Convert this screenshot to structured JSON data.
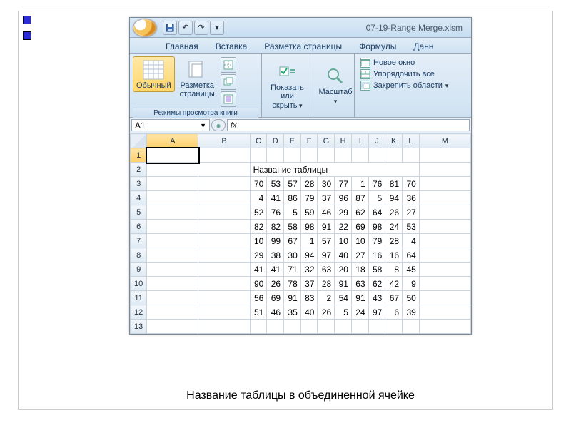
{
  "titlebar": {
    "filename": "07-19-Range Merge.xlsm"
  },
  "tabs": {
    "home": "Главная",
    "insert": "Вставка",
    "layout": "Разметка страницы",
    "formulas": "Формулы",
    "data": "Данн"
  },
  "ribbon": {
    "views_group_label": "Режимы просмотра книги",
    "normal": "Обычный",
    "pagelayout_l1": "Разметка",
    "pagelayout_l2": "страницы",
    "showhide_l1": "Показать",
    "showhide_l2": "или скрыть",
    "zoom": "Масштаб",
    "newwin": "Новое окно",
    "arrange": "Упорядочить все",
    "freeze": "Закрепить области"
  },
  "namebox": {
    "value": "A1"
  },
  "fx": {
    "label": "fx"
  },
  "sheet": {
    "columns": [
      "A",
      "B",
      "C",
      "D",
      "E",
      "F",
      "G",
      "H",
      "I",
      "J",
      "K",
      "L",
      "M"
    ],
    "row_numbers": [
      1,
      2,
      3,
      4,
      5,
      6,
      7,
      8,
      9,
      10,
      11,
      12,
      13
    ],
    "title_row": 2,
    "title_text": "Название таблицы",
    "data_start_row": 3,
    "data_rows": [
      [
        70,
        53,
        57,
        28,
        30,
        77,
        1,
        76,
        81,
        70
      ],
      [
        4,
        41,
        86,
        79,
        37,
        96,
        87,
        5,
        94,
        36
      ],
      [
        52,
        76,
        5,
        59,
        46,
        29,
        62,
        64,
        26,
        27
      ],
      [
        82,
        82,
        58,
        98,
        91,
        22,
        69,
        98,
        24,
        53
      ],
      [
        10,
        99,
        67,
        1,
        57,
        10,
        10,
        79,
        28,
        4
      ],
      [
        29,
        38,
        30,
        94,
        97,
        40,
        27,
        16,
        16,
        64
      ],
      [
        41,
        41,
        71,
        32,
        63,
        20,
        18,
        58,
        8,
        45
      ],
      [
        90,
        26,
        78,
        37,
        28,
        91,
        63,
        62,
        42,
        9
      ],
      [
        56,
        69,
        91,
        83,
        2,
        54,
        91,
        43,
        67,
        50
      ],
      [
        51,
        46,
        35,
        40,
        26,
        5,
        24,
        97,
        6,
        39
      ]
    ]
  },
  "caption": "Название таблицы в объединенной ячейке"
}
